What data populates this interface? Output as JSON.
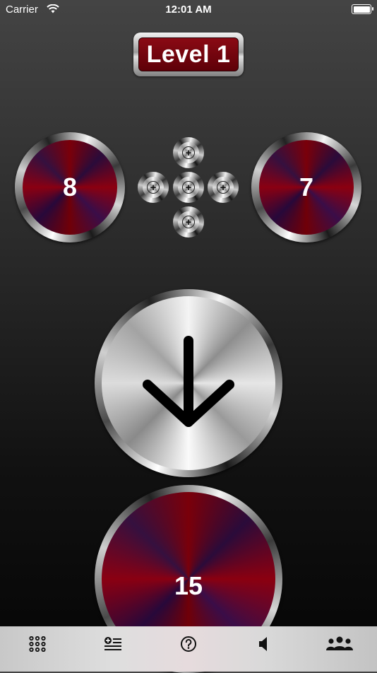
{
  "status_bar": {
    "carrier": "Carrier",
    "time": "12:01 AM"
  },
  "level": {
    "label": "Level 1"
  },
  "counters": {
    "left": "8",
    "right": "7",
    "bottom": "15"
  },
  "main_button": {
    "icon": "arrow-down-icon"
  },
  "dpad": {
    "icon": "plus-icon",
    "buttons": [
      "up",
      "left",
      "center",
      "right",
      "down"
    ]
  },
  "tab_bar": {
    "items": [
      {
        "icon": "grid-icon"
      },
      {
        "icon": "add-list-icon"
      },
      {
        "icon": "help-icon"
      },
      {
        "icon": "speaker-icon"
      },
      {
        "icon": "group-icon"
      }
    ]
  },
  "colors": {
    "level_red": "#7a0a12",
    "counter_red": "#7a000a",
    "counter_purple": "#2a0b3a",
    "tab_bar": "#d9d9d9"
  }
}
